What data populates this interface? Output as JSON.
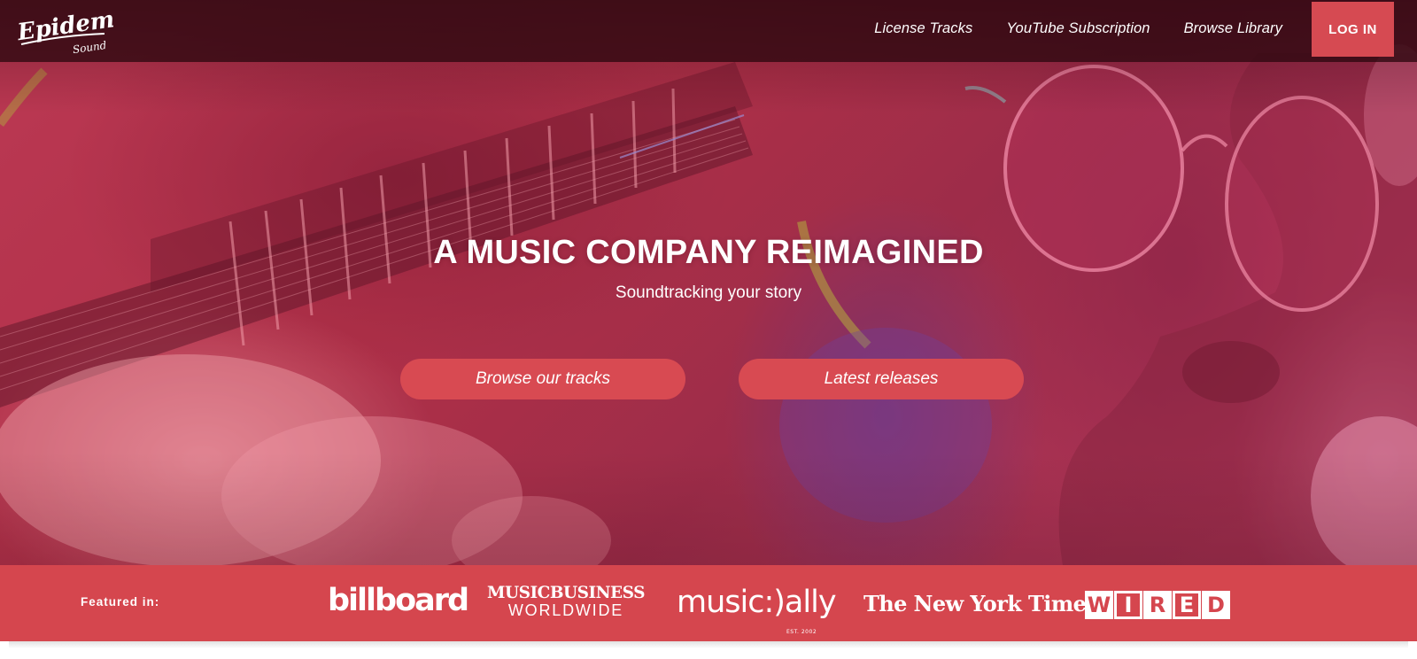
{
  "brand": {
    "logo_main": "Epidemic",
    "logo_sub": "Sound"
  },
  "nav": {
    "items": [
      {
        "label": "License Tracks"
      },
      {
        "label": "YouTube Subscription"
      },
      {
        "label": "Browse Library"
      }
    ],
    "login_label": "LOG IN"
  },
  "hero": {
    "headline": "A MUSIC COMPANY REIMAGINED",
    "subheadline": "Soundtracking your story",
    "cta_browse": "Browse our tracks",
    "cta_latest": "Latest releases"
  },
  "featured": {
    "label": "Featured in:",
    "logos": {
      "billboard": "billboard",
      "mbw_top": "MUSICBUSINESS",
      "mbw_bottom": "WORLDWIDE",
      "musically": "music:)ally",
      "musically_est": "EST. 2002",
      "nyt": "The New York Times",
      "wired": [
        "W",
        "I",
        "R",
        "E",
        "D"
      ]
    }
  },
  "colors": {
    "accent": "#d64a52",
    "navbar": "#2d0810",
    "featured_bar": "#d5464e"
  },
  "icons": {
    "logo": "epidemic-sound-logo"
  }
}
